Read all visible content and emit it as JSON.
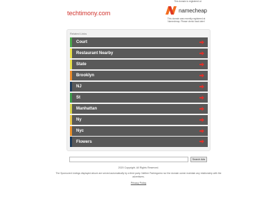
{
  "header": {
    "domain": "techtimony.com",
    "registered_note": "This domain is registered at",
    "registrar": "namecheap",
    "registrar_desc": "This domain was recently registered at Namecheap. Please check back later!"
  },
  "panel": {
    "title": "Related Links",
    "links": [
      {
        "label": "Court",
        "stripe": "#4aa84a"
      },
      {
        "label": "Restaurant Nearby",
        "stripe": "#e8e04a"
      },
      {
        "label": "State",
        "stripe": "#e8e04a"
      },
      {
        "label": "Brooklyn",
        "stripe": "#e88a2a"
      },
      {
        "label": "NJ",
        "stripe": "#1f3c5a"
      },
      {
        "label": "St",
        "stripe": "#3a9a4a"
      },
      {
        "label": "Manhattan",
        "stripe": "#d8d44a"
      },
      {
        "label": "Ny",
        "stripe": "#e8c84a"
      },
      {
        "label": "Nyc",
        "stripe": "#e8902a"
      },
      {
        "label": "Flowers",
        "stripe": "#1f3c5a"
      }
    ],
    "arrow_color": "#e0302a"
  },
  "search": {
    "placeholder": "",
    "button_label": "Search Ads"
  },
  "footer": {
    "copyright": "2020 Copyright. All Rights Reserved.",
    "disclaimer": "The Sponsored Listings displayed above are served automatically by a third party. Neither Parkingcrew nor the domain owner maintain any relationship with the advertisers.",
    "privacy": "Privacy Policy"
  }
}
